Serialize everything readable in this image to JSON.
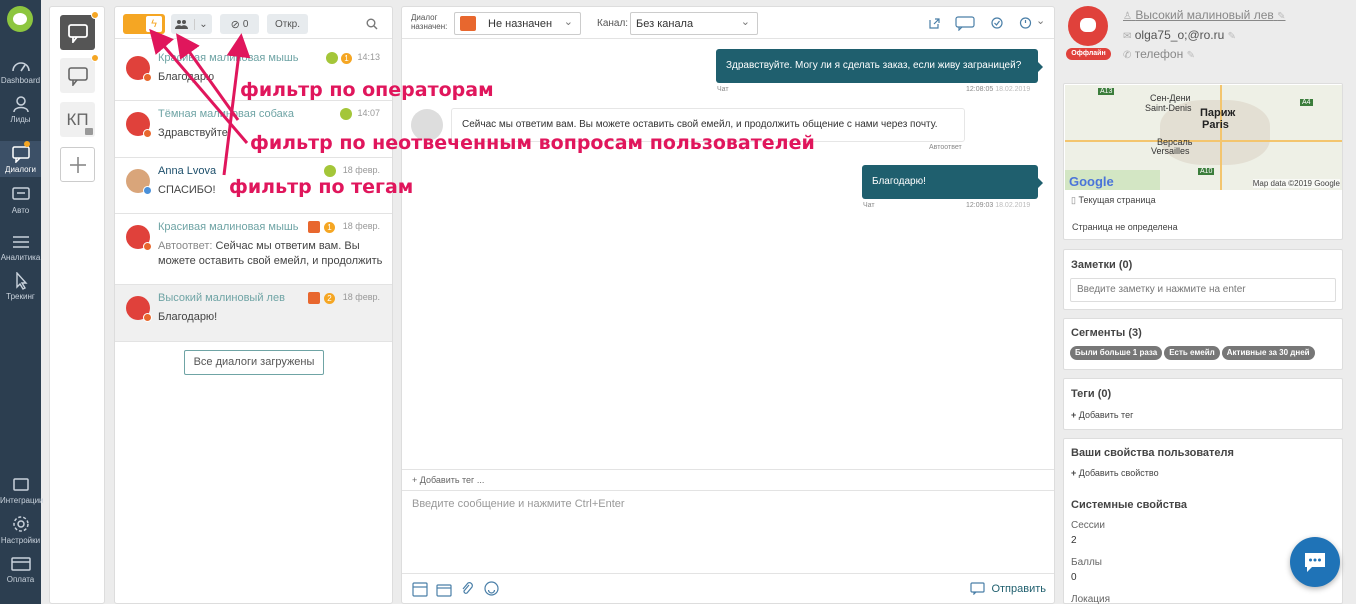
{
  "nav": {
    "items": [
      {
        "label": "Dashboard",
        "icon": "dashboard-icon"
      },
      {
        "label": "Лиды",
        "icon": "users-icon"
      },
      {
        "label": "Диалоги",
        "icon": "chat-icon"
      },
      {
        "label": "Авто",
        "icon": "auto-icon"
      },
      {
        "label": "Аналитика",
        "icon": "analytics-icon"
      },
      {
        "label": "Трекинг",
        "icon": "tracking-icon"
      },
      {
        "label": "Интеграции",
        "icon": "integrations-icon"
      },
      {
        "label": "Настройки",
        "icon": "settings-icon"
      },
      {
        "label": "Оплата",
        "icon": "payment-icon"
      }
    ]
  },
  "channels": {
    "kp_label": "КП"
  },
  "filters": {
    "tag_count": "0",
    "status_label": "Откр."
  },
  "conversations": [
    {
      "name": "Красивая малиновая мышь",
      "time": "14:13",
      "badge": "1",
      "message": "Благодарю",
      "avatar_color": "#e0413b"
    },
    {
      "name": "Тёмная малиновая собака",
      "time": "14:07",
      "badge": "",
      "message": "Здравствуйте!",
      "avatar_color": "#e0413b"
    },
    {
      "name": "Anna Lvova",
      "time": "18 февр.",
      "badge": "",
      "message": "СПАСИБО!",
      "avatar_color": "#d9a57a"
    },
    {
      "name": "Красивая малиновая мышь",
      "time": "18 февр.",
      "badge": "1",
      "message": "Сейчас мы ответим вам. Вы можете оставить свой емейл, и продолжить",
      "prefix": "Автоответ:",
      "avatar_color": "#e0413b"
    },
    {
      "name": "Высокий малиновый лев",
      "time": "18 февр.",
      "badge": "2",
      "message": "Благодарю!",
      "avatar_color": "#e0413b"
    }
  ],
  "all_loaded_label": "Все диалоги загружены",
  "chat_header": {
    "assigned_label_1": "Диалог",
    "assigned_label_2": "назначен:",
    "assigned_value": "Не назначен",
    "channel_label": "Канал:",
    "channel_value": "Без канала"
  },
  "messages": [
    {
      "text": "Здравствуйте. Могу ли я сделать заказ, если живу заграницей?",
      "source": "Чат",
      "time": "12:08:05",
      "date": "18.02.2019"
    },
    {
      "text": "Сейчас мы ответим вам. Вы можете оставить свой емейл, и продолжить общение с нами через почту.",
      "source": "Автоответ"
    },
    {
      "text": "Благодарю!",
      "source": "Чат",
      "time": "12:09:03",
      "date": "18.02.2019"
    }
  ],
  "composer": {
    "add_tag": "+ Добавить тег ...",
    "placeholder": "Введите сообщение и нажмите Ctrl+Enter",
    "send_label": "Отправить"
  },
  "user": {
    "name": "Высокий малиновый лев",
    "email": "olga75_o;@ro.ru",
    "phone": "телефон",
    "status": "Оффлайн"
  },
  "map": {
    "places": [
      "Сен-Дени",
      "Saint-Denis",
      "Париж",
      "Paris",
      "Версаль",
      "Versailles"
    ],
    "roads": [
      "A13",
      "A4",
      "A10"
    ],
    "google": "Google",
    "attribution": "Map data ©2019 Google",
    "current_page_label": "Текущая страница",
    "page_status": "Страница не определена"
  },
  "notes": {
    "title": "Заметки (0)",
    "placeholder": "Введите заметку и нажмите на enter"
  },
  "segments": {
    "title": "Сегменты (3)",
    "items": [
      "Были больше 1 раза",
      "Есть емейл",
      "Активные за 30 дней"
    ]
  },
  "tags": {
    "title": "Теги (0)",
    "add_label": "Добавить тег"
  },
  "props": {
    "title": "Ваши свойства пользователя",
    "add_label": "Добавить свойство",
    "system_title": "Системные свойства",
    "rows": [
      {
        "label": "Сессии",
        "value": "2"
      },
      {
        "label": "Баллы",
        "value": "0"
      },
      {
        "label": "Локация",
        "value": ""
      }
    ]
  },
  "annotations": {
    "a1": "фильтр по операторам",
    "a2": "фильтр по неотвеченным вопросам пользователей",
    "a3": "фильтр по тегам"
  },
  "colors": {
    "accent": "#1f5f6e",
    "orange": "#f5a623",
    "annotation": "#e0165c",
    "brand": "#e0413b"
  }
}
